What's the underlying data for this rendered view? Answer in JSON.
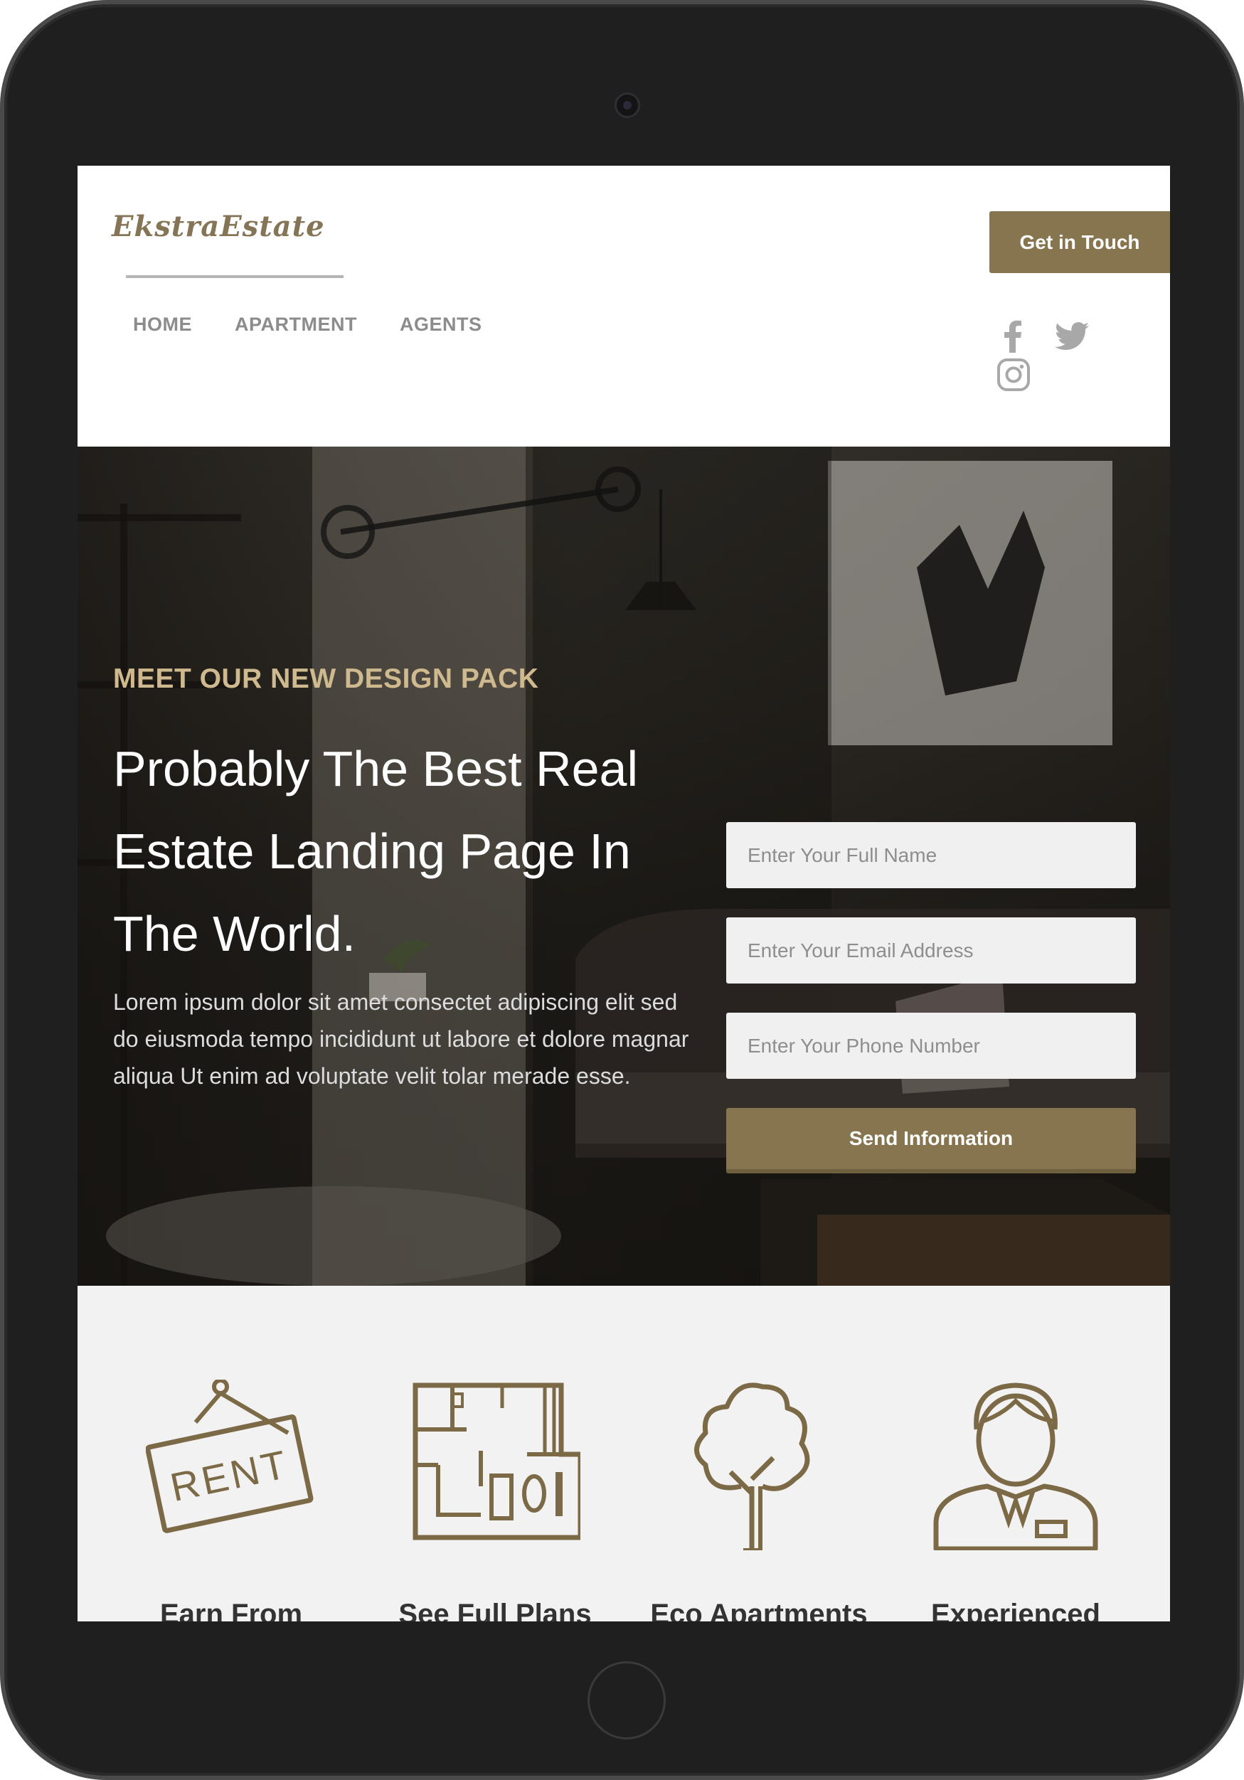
{
  "brand": {
    "logo": "EkstraEstate",
    "accent": "#87754f",
    "eyebrow_color": "#cfb98e"
  },
  "header": {
    "cta_label": "Get in Touch",
    "nav": [
      "HOME",
      "APARTMENT",
      "AGENTS"
    ],
    "social": [
      "facebook-icon",
      "twitter-icon",
      "instagram-icon"
    ]
  },
  "hero": {
    "eyebrow": "MEET OUR NEW DESIGN PACK",
    "headline": "Probably The Best Real Estate Landing Page In The World.",
    "lead": "Lorem ipsum dolor sit amet consectet adipiscing elit sed do eiusmoda tempo incididunt ut labore et dolore magnar aliqua Ut enim ad voluptate velit tolar merade esse."
  },
  "form": {
    "name_placeholder": "Enter Your Full Name",
    "email_placeholder": "Enter Your Email Address",
    "phone_placeholder": "Enter Your Phone Number",
    "submit_label": "Send Information"
  },
  "features": [
    {
      "icon": "rent-sign-icon",
      "label": "Earn From"
    },
    {
      "icon": "floor-plan-icon",
      "label": "See Full Plans"
    },
    {
      "icon": "tree-icon",
      "label": "Eco Apartments"
    },
    {
      "icon": "agent-icon",
      "label": "Experienced"
    }
  ]
}
